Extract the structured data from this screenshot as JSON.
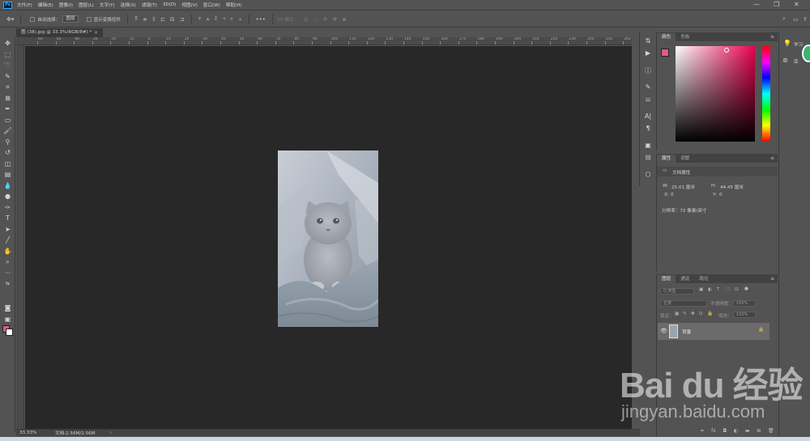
{
  "menubar": {
    "logo": "Ps",
    "items": [
      "文件(F)",
      "编辑(E)",
      "图像(I)",
      "图层(L)",
      "文字(Y)",
      "选择(S)",
      "滤镜(T)",
      "3D(D)",
      "视图(V)",
      "窗口(W)",
      "帮助(H)"
    ],
    "minimize": "—",
    "restore": "❐",
    "close": "✕"
  },
  "options": {
    "auto_select_label": "自动选择：",
    "auto_select_value": "图层",
    "show_transform_label": "显示变换控件",
    "more": "•••",
    "mode_3d_label": "3D 模式："
  },
  "document": {
    "tab_title": "图 (38).jpg @ 33.3%(RGB/8#) *",
    "close": "×"
  },
  "ruler_top_ticks": [
    "60",
    "50",
    "40",
    "30",
    "20",
    "10",
    "0",
    "10",
    "20",
    "30",
    "40",
    "50",
    "60",
    "70",
    "80",
    "90",
    "100",
    "110",
    "120",
    "130",
    "140",
    "150",
    "160",
    "170",
    "180",
    "190",
    "200",
    "210",
    "220",
    "230",
    "240",
    "250",
    "260",
    "270"
  ],
  "status": {
    "zoom": "33.33%",
    "doc_size": "文档:2.56M/2.56M",
    "arrow": "›"
  },
  "color_panel": {
    "tabs": [
      "颜色",
      "色板"
    ],
    "foreground": "#e25b82",
    "background": "#ffffff"
  },
  "properties_panel": {
    "tabs": [
      "属性",
      "调整"
    ],
    "section_title": "文档属性",
    "w_label": "W:",
    "w_value": "25.01 厘米",
    "h_label": "H:",
    "h_value": "44.45 厘米",
    "x_label": "X:",
    "x_value": "0",
    "y_label": "Y:",
    "y_value": "0",
    "resolution": "分辨率：72 像素/英寸"
  },
  "layers_panel": {
    "tabs": [
      "图层",
      "通道",
      "路径"
    ],
    "filter_kind": "Q 类型",
    "blend_mode": "正常",
    "opacity_label": "不透明度：",
    "opacity_value": "100%",
    "lock_label": "锁定：",
    "fill_label": "填充：",
    "fill_value": "100%",
    "layer_name": "背景"
  },
  "learn_strip": {
    "learn_label": "学习",
    "library_label": "库"
  },
  "watermark": {
    "brand": "Bai du 经验",
    "url": "jingyan.baidu.com"
  }
}
